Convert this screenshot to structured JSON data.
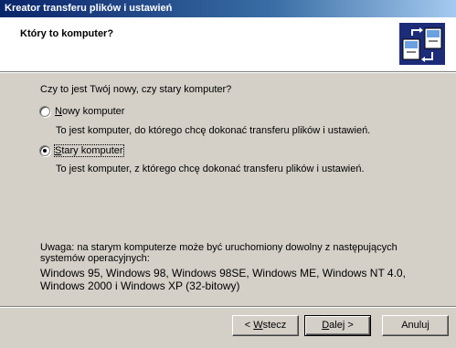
{
  "window": {
    "title": "Kreator transferu plików i ustawień"
  },
  "header": {
    "title": "Który to komputer?",
    "icon": "wizard-computers-icon"
  },
  "question": "Czy to jest Twój nowy, czy stary komputer?",
  "options": [
    {
      "label_ul": "N",
      "label_rest": "owy komputer",
      "description": "To jest komputer, do którego chcę dokonać transferu plików i ustawień.",
      "checked": false
    },
    {
      "label_ul": "S",
      "label_rest": "tary komputer",
      "description": "To jest komputer, z którego chcę dokonać transferu plików i ustawień.",
      "checked": true
    }
  ],
  "note": {
    "lines": [
      "Uwaga: na starym komputerze może być uruchomiony dowolny z następujących",
      "systemów operacyjnych:"
    ],
    "os_lines": [
      "Windows 95, Windows 98, Windows 98SE, Windows ME, Windows NT 4.0,",
      "Windows 2000 i Windows XP (32-bitowy)"
    ]
  },
  "buttons": {
    "back": {
      "prefix": "< ",
      "ul": "W",
      "rest": "stecz"
    },
    "next": {
      "prefix": "",
      "ul": "D",
      "rest": "alej >"
    },
    "cancel": {
      "label": "Anuluj"
    }
  }
}
